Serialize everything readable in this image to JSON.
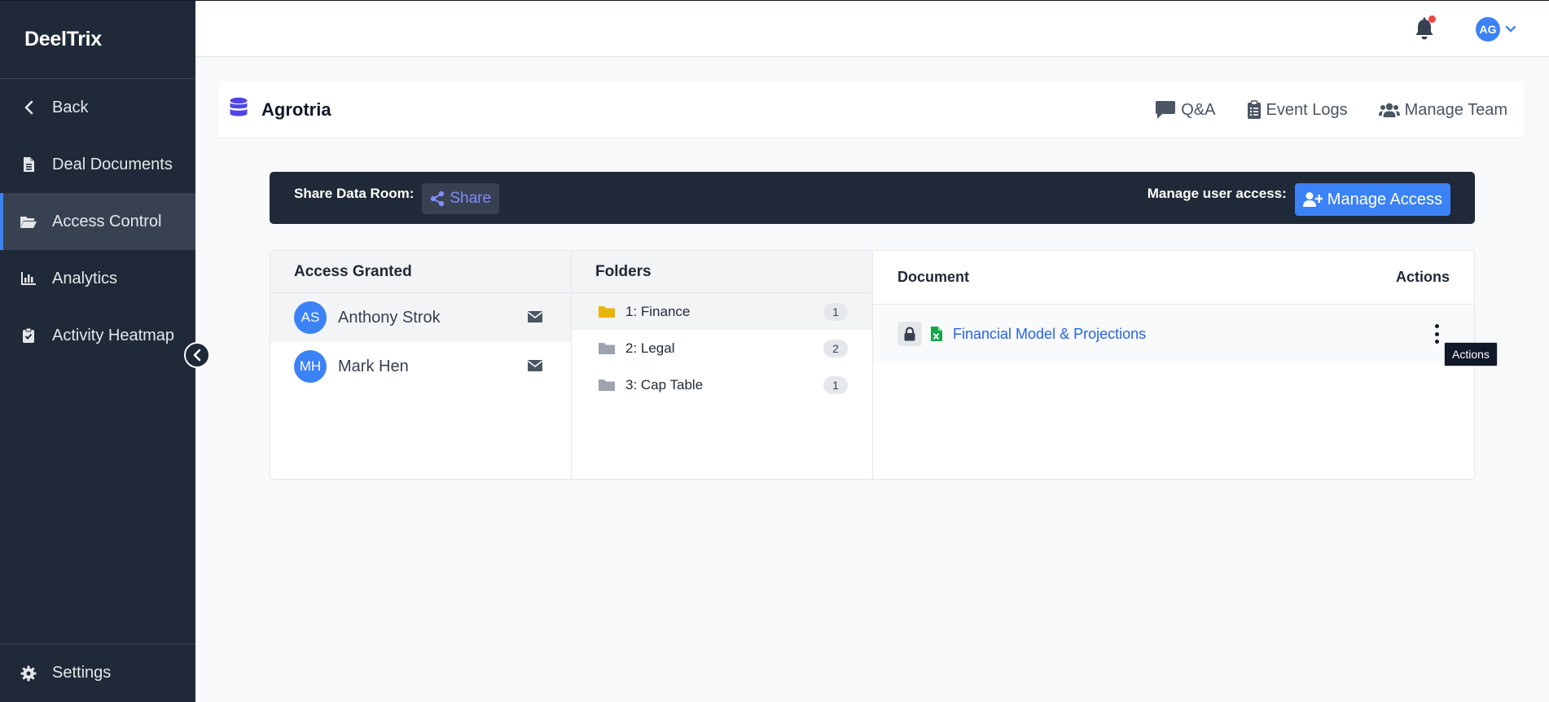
{
  "app": {
    "brand": "DeelTrix"
  },
  "sidebar": {
    "items": [
      {
        "label": "Back",
        "icon": "chevron-left-icon"
      },
      {
        "label": "Deal Documents",
        "icon": "file-icon"
      },
      {
        "label": "Access Control",
        "icon": "folder-open-icon",
        "active": true
      },
      {
        "label": "Analytics",
        "icon": "chart-bar-icon"
      },
      {
        "label": "Activity Heatmap",
        "icon": "clipboard-check-icon"
      }
    ],
    "settings_label": "Settings"
  },
  "topbar": {
    "user_initials": "AG",
    "has_notification": true
  },
  "header": {
    "title": "Agrotria",
    "actions": [
      {
        "label": "Q&A",
        "icon": "comment-icon"
      },
      {
        "label": "Event Logs",
        "icon": "clipboard-list-icon"
      },
      {
        "label": "Manage Team",
        "icon": "users-icon"
      }
    ]
  },
  "sharebar": {
    "share_label": "Share Data Room:",
    "share_button": "Share",
    "manage_label": "Manage user access:",
    "manage_button": "Manage Access"
  },
  "access": {
    "title": "Access Granted",
    "users": [
      {
        "initials": "AS",
        "name": "Anthony Strok",
        "selected": true
      },
      {
        "initials": "MH",
        "name": "Mark Hen",
        "selected": false
      }
    ]
  },
  "folders": {
    "title": "Folders",
    "items": [
      {
        "name": "1: Finance",
        "count": "1",
        "selected": true
      },
      {
        "name": "2: Legal",
        "count": "2",
        "selected": false
      },
      {
        "name": "3: Cap Table",
        "count": "1",
        "selected": false
      }
    ]
  },
  "documents": {
    "col_document": "Document",
    "col_actions": "Actions",
    "items": [
      {
        "name": "Financial Model & Projections"
      }
    ]
  },
  "tooltip": {
    "text": "Actions"
  },
  "colors": {
    "sidebar_bg": "#1f2937",
    "accent": "#3b82f6",
    "link": "#2563eb",
    "folder_active": "#eab308",
    "excel": "#16a34a"
  }
}
